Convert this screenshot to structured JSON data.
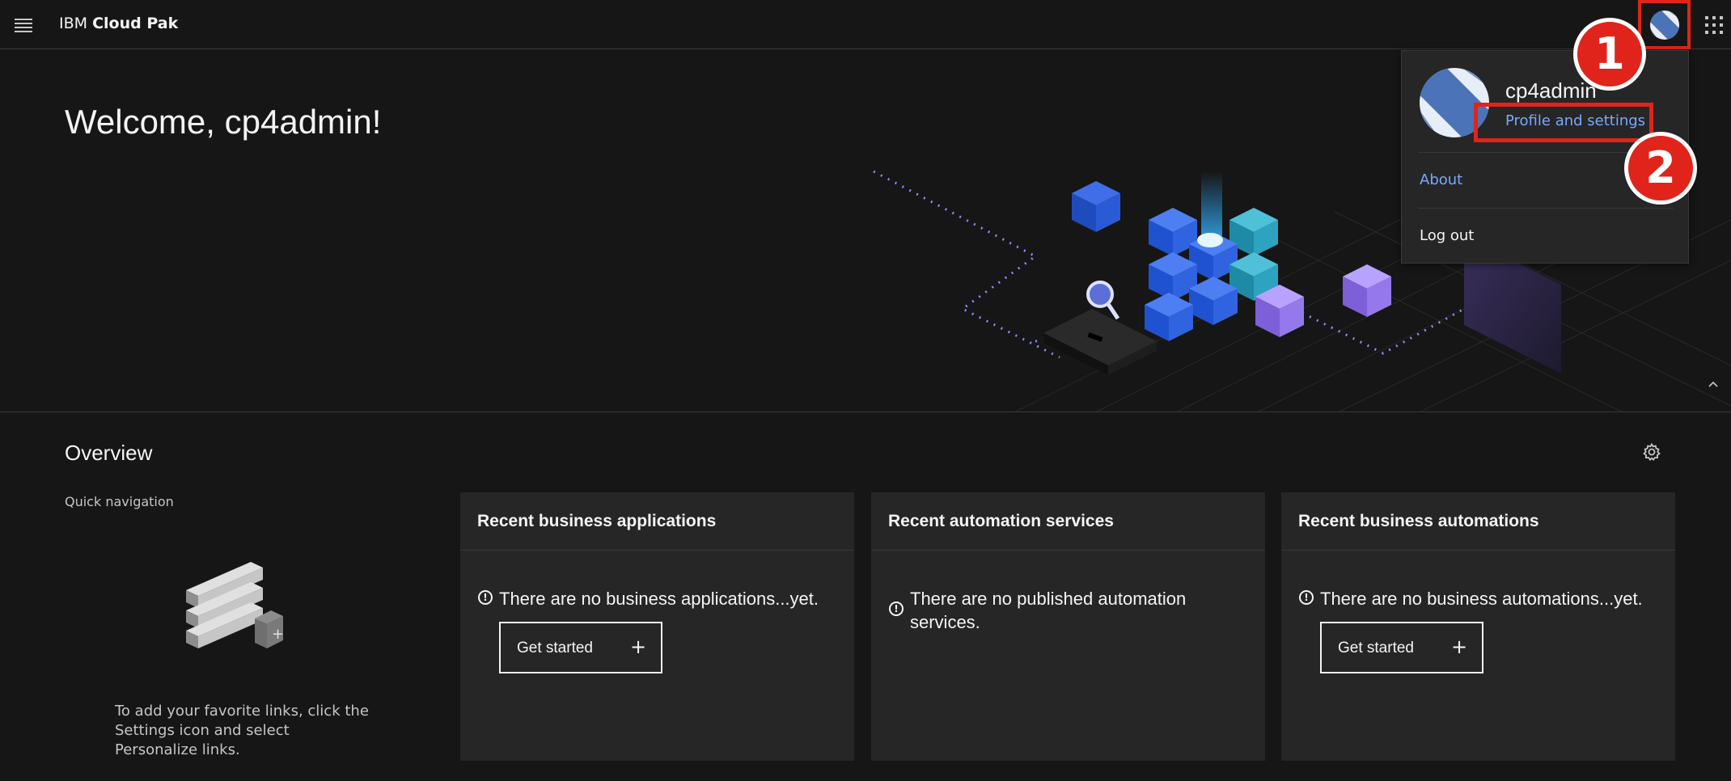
{
  "header": {
    "brand_prefix": "IBM",
    "brand_name": "Cloud Pak"
  },
  "hero": {
    "welcome": "Welcome, cp4admin!"
  },
  "user_menu": {
    "username": "cp4admin",
    "profile_link": "Profile and settings",
    "about_link": "About",
    "logout_link": "Log out"
  },
  "annotations": {
    "step1": "1",
    "step2": "2",
    "highlight_color": "#e0241b"
  },
  "overview": {
    "title": "Overview",
    "quick_nav_label": "Quick navigation",
    "quick_nav_text": "To add your favorite links, click the Settings icon and select Personalize links."
  },
  "cards": [
    {
      "title": "Recent business applications",
      "message": "There are no business applications...yet.",
      "button": "Get started"
    },
    {
      "title": "Recent automation services",
      "message": "There are no published automation services."
    },
    {
      "title": "Recent business automations",
      "message": "There are no business automations...yet.",
      "button": "Get started"
    }
  ],
  "colors": {
    "background": "#161616",
    "card": "#262626",
    "link": "#78a9ff",
    "text": "#f4f4f4"
  },
  "icons": [
    "menu-icon",
    "avatar-icon",
    "app-switcher-icon",
    "gear-icon",
    "info-icon",
    "plus-icon",
    "chevron-up-icon"
  ]
}
